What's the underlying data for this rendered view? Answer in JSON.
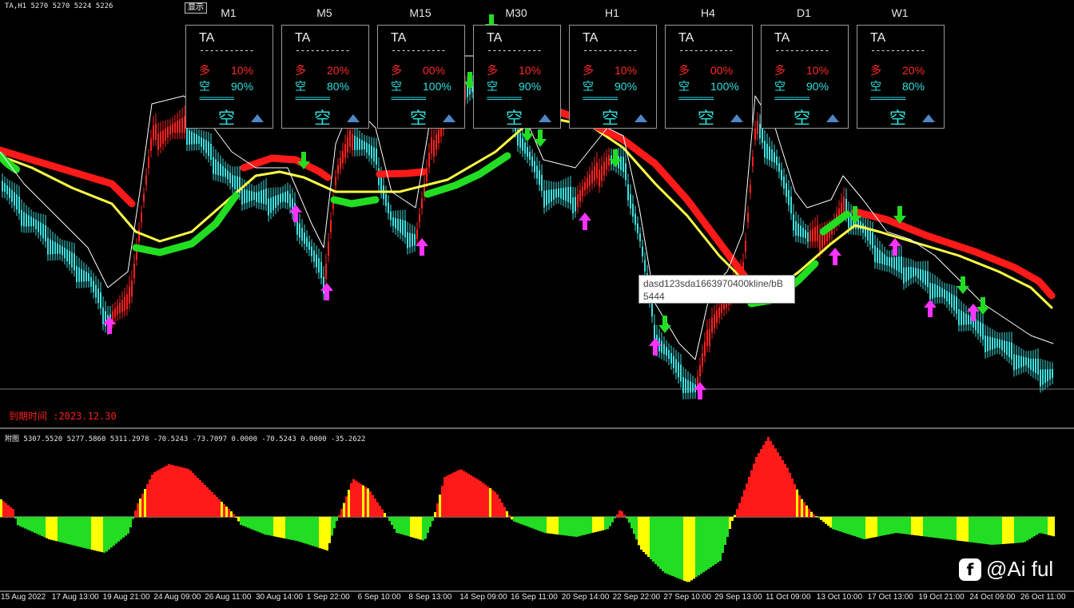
{
  "header": {
    "symbol_info": "TA,H1  5270 5270 5224 5226",
    "show_button": "显示"
  },
  "panels": [
    {
      "tf": "M1",
      "symbol": "TA",
      "long_label": "多",
      "long_pct": "10%",
      "short_label": "空",
      "short_pct": "90%",
      "signal": "空"
    },
    {
      "tf": "M5",
      "symbol": "TA",
      "long_label": "多",
      "long_pct": "20%",
      "short_label": "空",
      "short_pct": "80%",
      "signal": "空"
    },
    {
      "tf": "M15",
      "symbol": "TA",
      "long_label": "多",
      "long_pct": "00%",
      "short_label": "空",
      "short_pct": "100%",
      "signal": "空"
    },
    {
      "tf": "M30",
      "symbol": "TA",
      "long_label": "多",
      "long_pct": "10%",
      "short_label": "空",
      "short_pct": "90%",
      "signal": "空"
    },
    {
      "tf": "H1",
      "symbol": "TA",
      "long_label": "多",
      "long_pct": "10%",
      "short_label": "空",
      "short_pct": "90%",
      "signal": "空"
    },
    {
      "tf": "H4",
      "symbol": "TA",
      "long_label": "多",
      "long_pct": "00%",
      "short_label": "空",
      "short_pct": "100%",
      "signal": "空"
    },
    {
      "tf": "D1",
      "symbol": "TA",
      "long_label": "多",
      "long_pct": "10%",
      "short_label": "空",
      "short_pct": "90%",
      "signal": "空"
    },
    {
      "tf": "W1",
      "symbol": "TA",
      "long_label": "多",
      "long_pct": "20%",
      "short_label": "空",
      "short_pct": "80%",
      "signal": "空"
    }
  ],
  "panel_dash": "-----------",
  "panel_eq": "=======",
  "expiry": "到期时间 :2023.12.30",
  "tooltip": {
    "line1": "dasd123sda1663970400kline/bB",
    "line2": "5444"
  },
  "sub_info": "附图 5307.5520 5277.5860 5311.2978 -70.5243 -73.7097 0.0000 -70.5243 0.0000 -35.2622",
  "x_labels": [
    "15 Aug 2022",
    "17 Aug 13:00",
    "19 Aug 21:00",
    "24 Aug 09:00",
    "26 Aug 11:00",
    "30 Aug 14:00",
    "1 Sep 22:00",
    "6 Sep 10:00",
    "8 Sep 13:00",
    "14 Sep 09:00",
    "16 Sep 11:00",
    "20 Sep 14:00",
    "22 Sep 22:00",
    "27 Sep 10:00",
    "29 Sep 13:00",
    "11 Oct 09:00",
    "13 Oct 10:00",
    "17 Oct 13:00",
    "19 Oct 21:00",
    "24 Oct 09:00",
    "26 Oct 11:00"
  ],
  "watermark": {
    "icon": "f",
    "text": "@Ai ful"
  },
  "colors": {
    "bull": "#ff2020",
    "bear": "#3ee0e0",
    "band_red": "#ff1a1a",
    "band_green": "#22dd22",
    "ma_yellow": "#ffff44",
    "arrow_up": "#ff33ff",
    "arrow_down": "#22dd22",
    "hist_red": "#ff1a1a",
    "hist_yellow": "#ffff00",
    "hist_green": "#22dd22"
  }
}
